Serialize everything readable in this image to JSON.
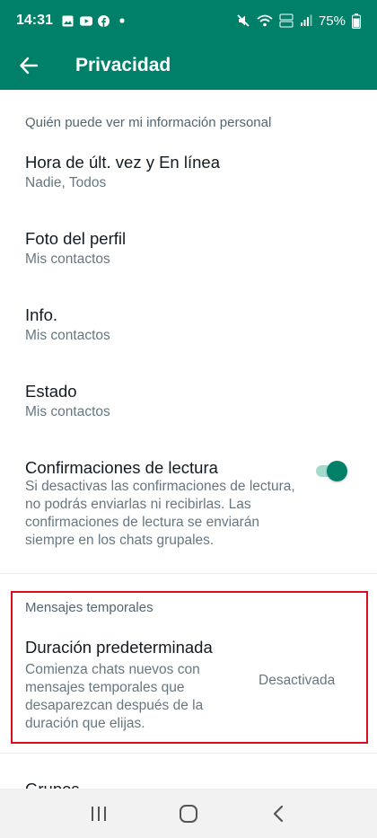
{
  "status_bar": {
    "time": "14:31",
    "battery": "75%",
    "icons": [
      "gallery-icon",
      "youtube-icon",
      "facebook-icon",
      "dot-icon",
      "mute-icon",
      "wifi-icon",
      "volte-icon",
      "signal-icon",
      "battery-icon"
    ]
  },
  "app_bar": {
    "title": "Privacidad",
    "background": "#008069"
  },
  "section1": {
    "header": "Quién puede ver mi información personal",
    "items": [
      {
        "title": "Hora de últ. vez y En línea",
        "subtitle": "Nadie, Todos"
      },
      {
        "title": "Foto del perfil",
        "subtitle": "Mis contactos"
      },
      {
        "title": "Info.",
        "subtitle": "Mis contactos"
      },
      {
        "title": "Estado",
        "subtitle": "Mis contactos"
      }
    ],
    "read_receipts": {
      "title": "Confirmaciones de lectura",
      "description": "Si desactivas las confirmaciones de lectura, no podrás enviarlas ni recibirlas. Las confirmaciones de lectura se enviarán siempre en los chats grupales.",
      "enabled": true
    }
  },
  "section2": {
    "header": "Mensajes temporales",
    "default_duration": {
      "title": "Duración predeterminada",
      "description": "Comienza chats nuevos con mensajes temporales que desaparezcan después de la duración que elijas.",
      "value": "Desactivada"
    }
  },
  "groups": {
    "title": "Grupos"
  },
  "colors": {
    "accent": "#008069",
    "highlight_border": "#d90d1e",
    "toggle_track": "#a5d9cd"
  }
}
